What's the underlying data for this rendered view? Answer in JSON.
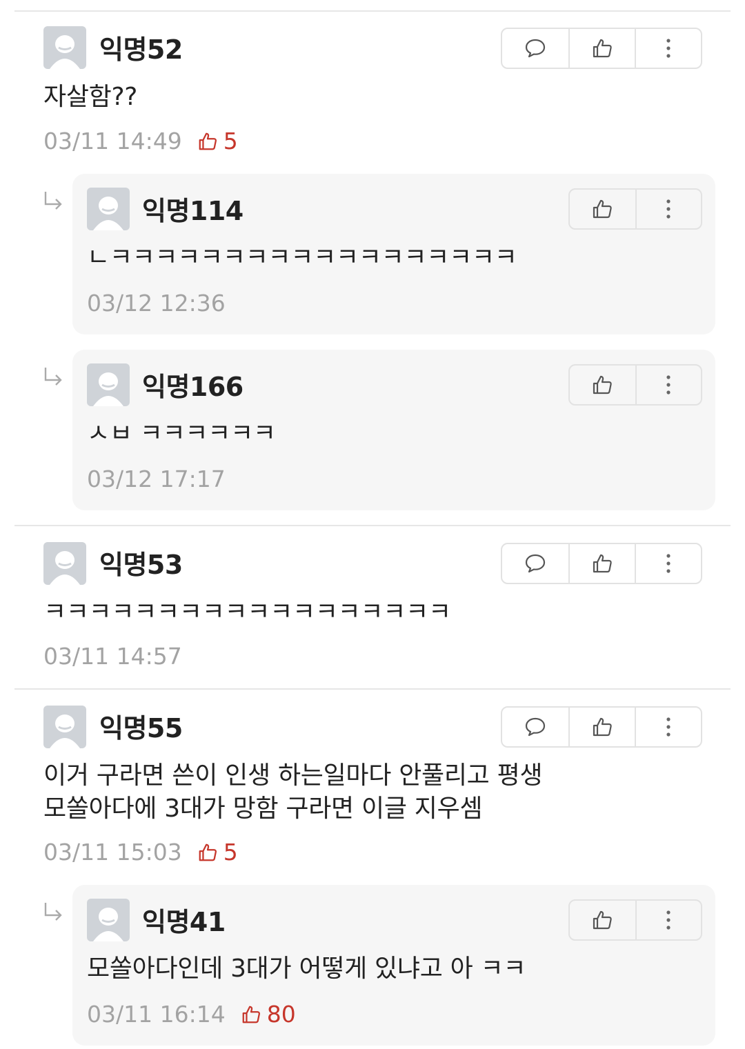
{
  "comments": [
    {
      "name": "익명52",
      "text": "자살함??",
      "time": "03/11 14:49",
      "likes": "5",
      "replies": [
        {
          "name": "익명114",
          "text": "ㄴㅋㅋㅋㅋㅋㅋㅋㅋㅋㅋㅋㅋㅋㅋㅋㅋㅋㅋ",
          "time": "03/12 12:36"
        },
        {
          "name": "익명166",
          "text": "ㅅㅂ ㅋㅋㅋㅋㅋㅋ",
          "time": "03/12 17:17"
        }
      ]
    },
    {
      "name": "익명53",
      "text": "ㅋㅋㅋㅋㅋㅋㅋㅋㅋㅋㅋㅋㅋㅋㅋㅋㅋㅋ",
      "time": "03/11 14:57"
    },
    {
      "name": "익명55",
      "text": "이거 구라면 쓴이 인생 하는일마다 안풀리고 평생\n모쏠아다에 3대가 망함 구라면 이글 지우셈",
      "time": "03/11 15:03",
      "likes": "5",
      "replies": [
        {
          "name": "익명41",
          "text": "모쏠아다인데 3대가 어떻게 있냐고 아 ㅋㅋ",
          "time": "03/11 16:14",
          "likes": "80"
        }
      ]
    }
  ],
  "icons": {
    "reply": "speech-bubble-icon",
    "like": "thumbs-up-icon",
    "more": "more-vertical-icon",
    "reply_indicator": "reply-arrow-icon",
    "avatar": "default-avatar-icon"
  },
  "colors": {
    "like_count": "#c6362b",
    "meta_text": "#a3a3a3",
    "reply_background": "#f6f6f6",
    "avatar_background": "#cfd3d8"
  }
}
